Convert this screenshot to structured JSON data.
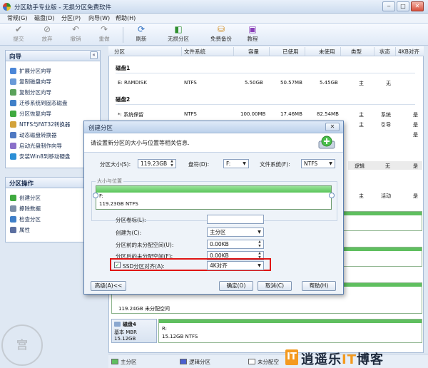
{
  "window": {
    "title": "分区助手专业版 - 无损分区免费软件",
    "controls": [
      "‒",
      "□",
      "✕"
    ]
  },
  "menu": [
    "常规(G)",
    "磁盘(D)",
    "分区(P)",
    "向导(W)",
    "帮助(H)"
  ],
  "toolbar": [
    {
      "label": "提交",
      "icon": "commit-icon"
    },
    {
      "label": "放弃",
      "icon": "discard-icon"
    },
    {
      "label": "撤销",
      "icon": "undo-icon"
    },
    {
      "label": "重做",
      "icon": "redo-icon"
    },
    {
      "label": "刷新",
      "icon": "refresh-icon"
    },
    {
      "label": "无损分区",
      "icon": "lossless-partition-icon"
    },
    {
      "label": "免费备份",
      "icon": "free-backup-icon"
    },
    {
      "label": "教程",
      "icon": "tutorial-icon"
    }
  ],
  "wizard_panel": {
    "title": "向导",
    "collapse": "«",
    "items": [
      "扩展分区向导",
      "复制磁盘向导",
      "复制分区向导",
      "迁移系统到固态磁盘",
      "分区恢复向导",
      "NTFS与FAT32转换器",
      "动态磁盘转换器",
      "启动光盘制作向导",
      "安装Win8到移动硬盘"
    ]
  },
  "ops_panel": {
    "title": "分区操作",
    "items": [
      "创建分区",
      "擦除数据",
      "检查分区",
      "属性"
    ]
  },
  "table": {
    "headers": [
      "分区",
      "文件系统",
      "容量",
      "已使用",
      "未使用",
      "类型",
      "状态",
      "4KB对齐"
    ],
    "groups": [
      {
        "name": "磁盘1",
        "rows": [
          [
            "E: RAMDISK",
            "NTFS",
            "5.50GB",
            "50.57MB",
            "5.45GB",
            "主",
            "无",
            ""
          ]
        ]
      },
      {
        "name": "磁盘2",
        "rows": [
          [
            "*: 系统保留",
            "NTFS",
            "100.00MB",
            "17.46MB",
            "82.54MB",
            "主",
            "系统",
            "是"
          ]
        ]
      }
    ],
    "partial_right": [
      {
        "type": "主",
        "status": "引导",
        "align": "是"
      },
      {
        "type": "",
        "status": "",
        "align": "是"
      },
      {
        "type": "逻辑",
        "status": "无",
        "align": "是"
      },
      {
        "type": "主",
        "status": "活动",
        "align": "是"
      }
    ]
  },
  "disk_map": {
    "fragment": "119.24GB 未分配空间",
    "disk4": {
      "name": "磁盘4",
      "type": "基本 MBR",
      "size": "15.12GB",
      "part_label": "R:",
      "part_desc": "15.12GB NTFS"
    }
  },
  "legend": [
    "主分区",
    "逻辑分区",
    "未分配空"
  ],
  "brand": {
    "mark": "IT",
    "text_a": "逍遥乐",
    "text_it": "IT",
    "text_b": "博客"
  },
  "watermark": "宫",
  "dialog": {
    "title": "创建分区",
    "close": "✕",
    "description": "请设置新分区的大小与位置等相关信息.",
    "size_label": "分区大小(S):",
    "size_value": "119.23GB",
    "drive_label": "盘符(D):",
    "drive_value": "F:",
    "fs_label": "文件系统(F):",
    "fs_value": "NTFS",
    "sizebar_title": "大小与位置",
    "bar_label": "F:",
    "bar_desc": "119.23GB NTFS",
    "volume_label": "分区卷标(L):",
    "volume_value": "",
    "create_as_label": "创建为(C):",
    "create_as_value": "主分区",
    "before_label": "分区前的未分配空间(U):",
    "before_value": "0.00KB",
    "after_label": "分区后的未分配空间(F):",
    "after_value": "0.00KB",
    "ssd_label": "SSD分区对齐(A):",
    "ssd_value": "4K对齐",
    "ssd_checked": "✓",
    "advanced": "高级(A)<<",
    "ok": "确定(O)",
    "cancel": "取消(C)",
    "help": "帮助(H)"
  },
  "colors": {
    "primary_partition": "#5fbf5f",
    "logical_partition": "#4a5fd0",
    "unallocated": "#ffffff",
    "highlight": "#e01515"
  }
}
